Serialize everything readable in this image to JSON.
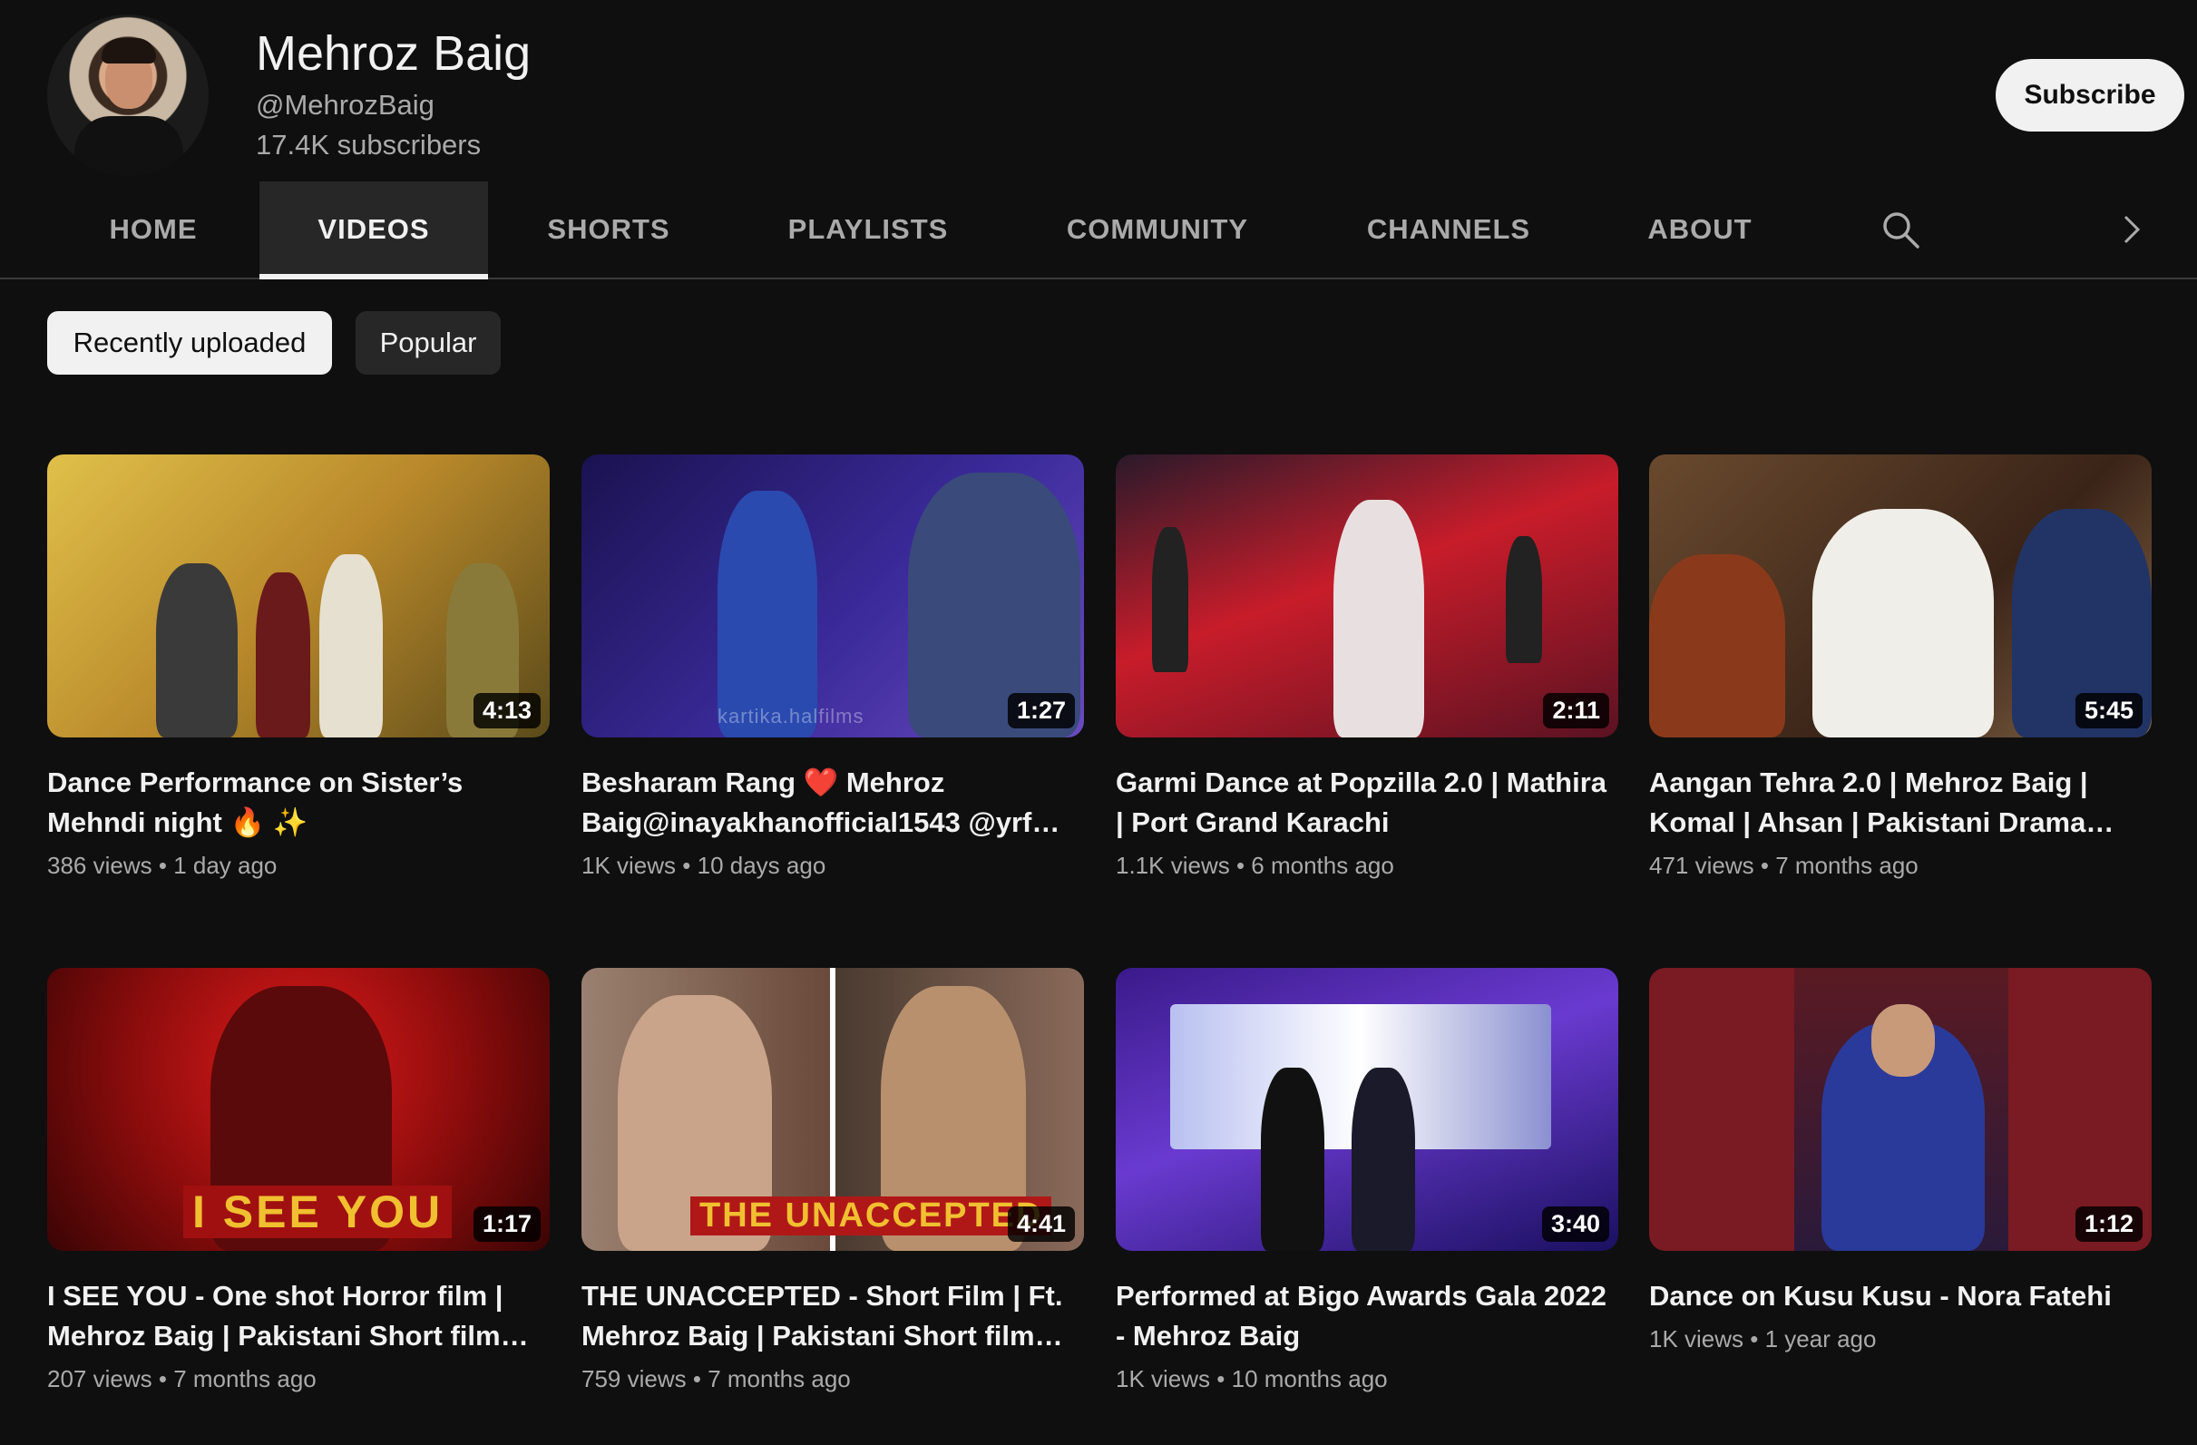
{
  "channel": {
    "name": "Mehroz Baig",
    "handle": "@MehrozBaig",
    "subscribers": "17.4K subscribers",
    "subscribe_label": "Subscribe"
  },
  "tabs": [
    {
      "label": "HOME"
    },
    {
      "label": "VIDEOS",
      "active": true
    },
    {
      "label": "SHORTS"
    },
    {
      "label": "PLAYLISTS"
    },
    {
      "label": "COMMUNITY"
    },
    {
      "label": "CHANNELS"
    },
    {
      "label": "ABOUT"
    }
  ],
  "icons": {
    "search": "search-icon",
    "next": "chevron-right-icon"
  },
  "chips": [
    {
      "label": "Recently uploaded",
      "selected": true
    },
    {
      "label": "Popular",
      "selected": false
    }
  ],
  "videos": [
    {
      "title": "Dance Performance on Sister’s Mehndi night 🔥 ✨",
      "views": "386 views",
      "age": "1 day ago",
      "duration": "4:13",
      "colors": [
        "#d4a93a",
        "#7b6a2a"
      ]
    },
    {
      "title": "Besharam Rang ❤️ Mehroz Baig@inayakhanofficial1543 @yrf…",
      "views": "1K views",
      "age": "10 days ago",
      "duration": "1:27",
      "watermark": "kartika.halfilms",
      "colors": [
        "#2a1c6e",
        "#5b3aa8"
      ]
    },
    {
      "title": "Garmi Dance at Popzilla 2.0 | Mathira | Port Grand Karachi",
      "views": "1.1K views",
      "age": "6 months ago",
      "duration": "2:11",
      "colors": [
        "#a01c2a",
        "#3a1620"
      ]
    },
    {
      "title": "Aangan Tehra 2.0 | Mehroz Baig | Komal | Ahsan | Pakistani Drama…",
      "views": "471 views",
      "age": "7 months ago",
      "duration": "5:45",
      "colors": [
        "#5a3a28",
        "#b88a6a"
      ]
    },
    {
      "title": "I SEE YOU - One shot Horror film | Mehroz Baig | Pakistani Short film…",
      "views": "207 views",
      "age": "7 months ago",
      "duration": "1:17",
      "overlay": "I SEE YOU",
      "colors": [
        "#8a0c0c",
        "#d01818"
      ]
    },
    {
      "title": "THE UNACCEPTED - Short Film | Ft. Mehroz Baig | Pakistani Short film…",
      "views": "759 views",
      "age": "7 months ago",
      "duration": "4:41",
      "overlay": "THE UNACCEPTED",
      "colors": [
        "#6a4a3a",
        "#c9a48a"
      ]
    },
    {
      "title": "Performed at Bigo Awards Gala 2022 - Mehroz Baig",
      "views": "1K views",
      "age": "10 months ago",
      "duration": "3:40",
      "colors": [
        "#2a1a8a",
        "#8a4ad0"
      ]
    },
    {
      "title": "Dance on Kusu Kusu - Nora Fatehi",
      "views": "1K views",
      "age": "1 year ago",
      "duration": "1:12",
      "colors": [
        "#7a1a22",
        "#2a2a6a"
      ]
    }
  ]
}
